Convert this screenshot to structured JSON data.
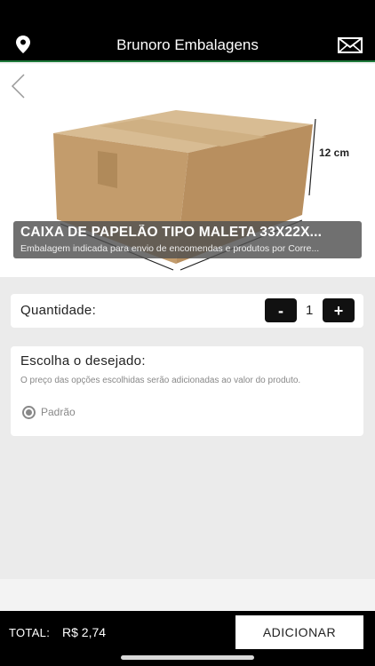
{
  "header": {
    "title": "Brunoro Embalagens",
    "location_icon": "map-pin-icon",
    "mail_icon": "envelope-icon"
  },
  "product": {
    "name": "CAIXA DE PAPELÃO TIPO MALETA 33X22X...",
    "description": "Embalagem indicada para envio de encomendas e produtos por Corre...",
    "dimension_label": "12 cm"
  },
  "quantity": {
    "label": "Quantidade:",
    "minus": "-",
    "value": "1",
    "plus": "+"
  },
  "options": {
    "heading": "Escolha o desejado:",
    "note": "O preço das opções escolhidas serão adicionadas ao valor do produto.",
    "items": [
      {
        "label": "Padrão",
        "selected": true
      }
    ]
  },
  "footer": {
    "total_label": "TOTAL:",
    "total_value": "R$ 2,74",
    "add_button": "ADICIONAR"
  },
  "colors": {
    "header_bg": "#000000",
    "accent_line": "#1e7a3a",
    "box": "#c9a67a"
  }
}
